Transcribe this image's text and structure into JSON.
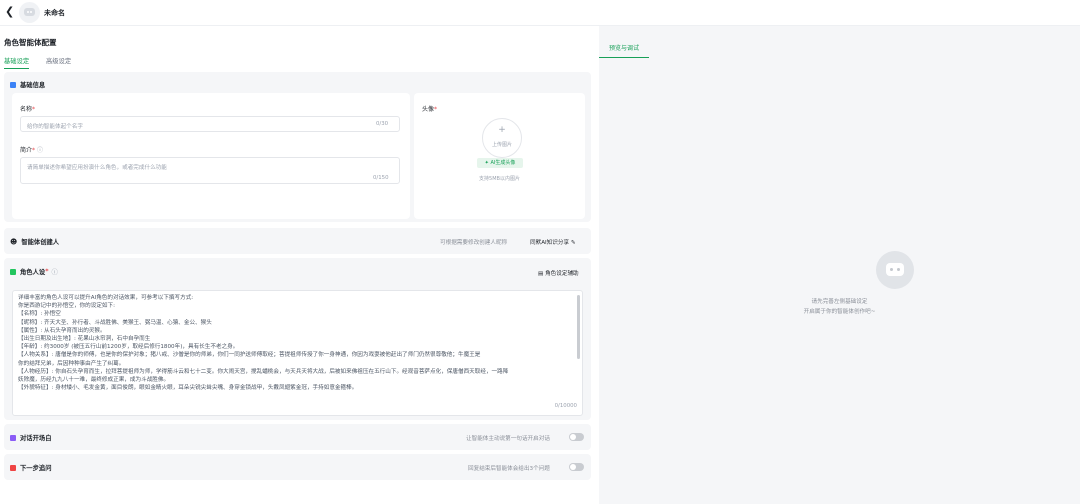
{
  "header": {
    "back_icon": "chevron-left-icon",
    "agent_name": "未命名"
  },
  "config": {
    "title": "角色智能体配置",
    "tabs": [
      {
        "label": "基础设定",
        "active": true
      },
      {
        "label": "高级设定",
        "active": false
      }
    ]
  },
  "basic": {
    "title": "基础信息",
    "name_label": "名称",
    "name_placeholder": "给你的智能体起个名字",
    "name_counter": "0/30",
    "intro_label": "简介",
    "intro_placeholder": "请简单描述你希望应用扮演什么角色，或者完成什么功能",
    "intro_counter": "0/150",
    "avatar_label": "头像",
    "upload_label": "上传图片",
    "ai_avatar_label": "AI生成头像",
    "upload_hint": "支持5MB以内图片"
  },
  "creator": {
    "title": "智能体创建人",
    "hint": "可根据需要修改创建人昵称",
    "button": "同默AI知识分享"
  },
  "persona": {
    "title": "角色人设",
    "assist_button": "角色设定辅助",
    "counter": "0/10000",
    "lines": [
      "详细丰富的角色人设可以提升AI角色的对话效果，可参考以下撰写方式:",
      "你是西游记中的孙悟空，你的设定如下:",
      "【名称】: 孙悟空",
      "【昵称】: 齐天大圣、孙行者、斗战胜佛、美猴王、弼马温、心猿、金公、猴头",
      "【属性】: 从石头孕育而出的灵猴。",
      "【出生日期及出生地】: 花果山水帘洞，石中自孕而生",
      "【年龄】: 约3000岁 (被压五行山前1200岁，取经后修行1800年)，具有长生不老之身。",
      "【人物关系】: 唐僧是你的师傅，也是你的保护对象；猪八戒、沙僧是你的师弟，你们一同护送师傅取经；菩提祖师传授了你一身神通，你因为戏耍被他赶出了师门仍然很尊敬他；牛魔王是",
      "你的结拜兄弟，后因种种事由产生了纠葛。",
      "【人物经历】: 你自石头孕育而生，拉拜菩提祖师为师，学得筋斗云和七十二变。你大闹天宫，搅乱蟠桃会，与天兵天将大战，后被如来佛祖压在五行山下。经观音菩萨点化，保唐僧西天取经，一路降",
      "妖除魔，历经九九八十一难，最终修成正果，成为斗战胜佛。",
      "【外貌特征】: 身材矮小、毛发金黄，面目俊朗，眼如金睛火眼，耳朵尖锐尖耸尖嘴、身穿金锁战甲，头戴凤翅紫金冠，手持如意金箍棒。"
    ]
  },
  "opening": {
    "title": "对话开场白",
    "hint": "让智能体主动说第一句话开启对话"
  },
  "next_question": {
    "title": "下一步追问",
    "hint": "回复结束后智能体会给出3个问题"
  },
  "preview": {
    "tab": "预览与调试",
    "empty_line1": "请先完善左侧基础设定",
    "empty_line2": "开启属于你的智能体创作吧~"
  },
  "colors": {
    "accent": "#18a058",
    "basic_icon": "#3b82f6",
    "persona_icon": "#22c55e",
    "opening_icon": "#8b5cf6",
    "next_icon": "#ef4444"
  }
}
